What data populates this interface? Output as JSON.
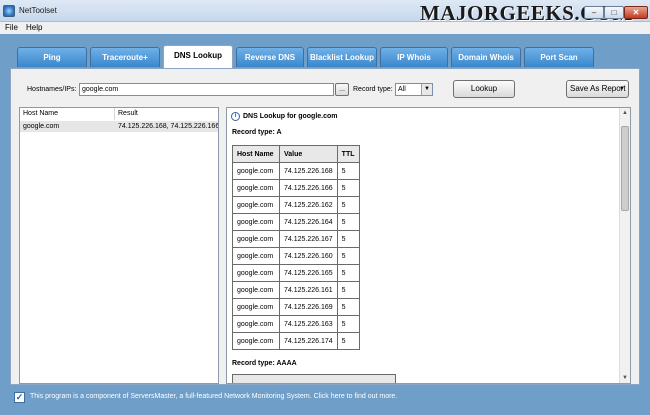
{
  "window": {
    "title": "NetToolset",
    "watermark": "MAJORGEEKS.COM",
    "controls": {
      "minimize": "–",
      "maximize": "□",
      "close": "✕"
    }
  },
  "menu": [
    "File",
    "Help"
  ],
  "tabs": [
    {
      "label": "Ping",
      "active": false
    },
    {
      "label": "Traceroute+",
      "active": false
    },
    {
      "label": "DNS Lookup",
      "active": true
    },
    {
      "label": "Reverse DNS",
      "active": false
    },
    {
      "label": "Blacklist Lookup",
      "active": false
    },
    {
      "label": "IP Whois",
      "active": false
    },
    {
      "label": "Domain Whois",
      "active": false
    },
    {
      "label": "Port Scan",
      "active": false
    }
  ],
  "toolbar": {
    "hostnames_label": "Hostnames/IPs:",
    "hostnames_value": "google.com",
    "browse_label": "...",
    "record_type_label": "Record type:",
    "record_type_value": "All",
    "lookup_label": "Lookup",
    "save_report_label": "Save As Report"
  },
  "results_list": {
    "columns": [
      "Host Name",
      "Result"
    ],
    "rows": [
      {
        "host": "google.com",
        "result": "74.125.226.168, 74.125.226.166, 74"
      }
    ]
  },
  "report": {
    "title": "DNS Lookup for google.com",
    "record_a_label": "Record type: A",
    "columns": [
      "Host Name",
      "Value",
      "TTL"
    ],
    "rows": [
      [
        "google.com",
        "74.125.226.168",
        "5"
      ],
      [
        "google.com",
        "74.125.226.166",
        "5"
      ],
      [
        "google.com",
        "74.125.226.162",
        "5"
      ],
      [
        "google.com",
        "74.125.226.164",
        "5"
      ],
      [
        "google.com",
        "74.125.226.167",
        "5"
      ],
      [
        "google.com",
        "74.125.226.160",
        "5"
      ],
      [
        "google.com",
        "74.125.226.165",
        "5"
      ],
      [
        "google.com",
        "74.125.226.161",
        "5"
      ],
      [
        "google.com",
        "74.125.226.169",
        "5"
      ],
      [
        "google.com",
        "74.125.226.163",
        "5"
      ],
      [
        "google.com",
        "74.125.226.174",
        "5"
      ]
    ],
    "record_aaaa_label": "Record type: AAAA"
  },
  "footer": {
    "checked": "✓",
    "text": "This program is a component of ServersMaster, a full-featured Network Monitoring System. Click here to find out more."
  }
}
